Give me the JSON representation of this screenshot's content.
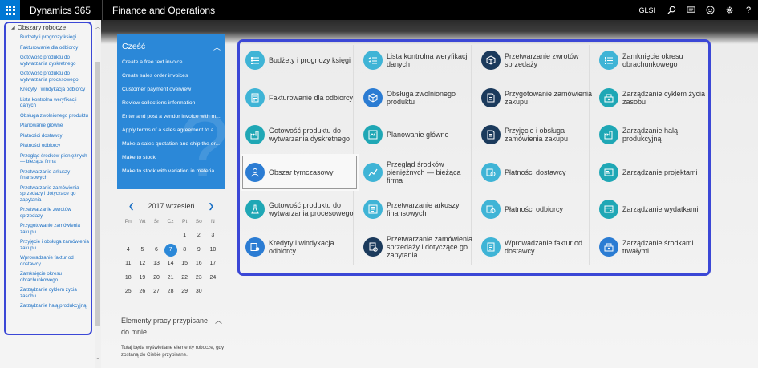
{
  "topbar": {
    "app_name": "Dynamics 365",
    "module_name": "Finance and Operations",
    "company": "GLSI"
  },
  "sidebar": {
    "header": "Obszary robocze",
    "items": [
      "Budżety i prognozy księgi",
      "Fakturowanie dla odbiorcy",
      "Gotowość produktu do wytwarzania dyskretnego",
      "Gotowość produktu do wytwarzania procesowego",
      "Kredyty i windykacja odbiorcy",
      "Lista kontrolna weryfikacji danych",
      "Obsługa zwolnionego produktu",
      "Planowanie główne",
      "Płatności dostawcy",
      "Płatności odbiorcy",
      "Przegląd środków pieniężnych — bieżąca firma",
      "Przetwarzanie arkuszy finansowych",
      "Przetwarzanie zamówienia sprzedaży i dotyczące go zapytania",
      "Przetwarzanie zwrotów sprzedaży",
      "Przygotowanie zamówienia zakupu",
      "Przyjęcie i obsługa zamówienia zakupu",
      "Wprowadzanie faktur od dostawcy",
      "Zamknięcie okresu obrachunkowego",
      "Zarządzanie cyklem życia zasobu",
      "Zarządzanie halą produkcyjną"
    ]
  },
  "frequent": {
    "title": "Cześć",
    "items": [
      "Create a free text invoice",
      "Create sales order invoices",
      "Customer payment overview",
      "Review collections information",
      "Enter and post a vendor invoice with m...",
      "Apply terms of a sales agreement to a...",
      "Make a sales quotation and ship the or...",
      "Make to stock",
      "Make to stock with variation in materia..."
    ]
  },
  "calendar": {
    "month_label": "2017 wrzesień",
    "weekdays": [
      "Pn",
      "Wt",
      "Śr",
      "Cz",
      "Pt",
      "So",
      "N"
    ],
    "rows": [
      [
        "",
        "",
        "",
        "",
        "1",
        "2",
        "3"
      ],
      [
        "4",
        "5",
        "6",
        "7",
        "8",
        "9",
        "10"
      ],
      [
        "11",
        "12",
        "13",
        "14",
        "15",
        "16",
        "17"
      ],
      [
        "18",
        "19",
        "20",
        "21",
        "22",
        "23",
        "24"
      ],
      [
        "25",
        "26",
        "27",
        "28",
        "29",
        "30",
        ""
      ]
    ],
    "today": "7"
  },
  "assigned": {
    "title": "Elementy pracy przypisane do mnie",
    "description": "Tutaj będą wyświetlane elementy robocze, gdy zostaną do Ciebie przypisane."
  },
  "tiles": [
    {
      "label": "Budżety i prognozy księgi",
      "color": "teal",
      "icon": "list-icon"
    },
    {
      "label": "Lista kontrolna weryfikacji danych",
      "color": "teal",
      "icon": "checklist-icon"
    },
    {
      "label": "Przetwarzanie zwrotów sprzedaży",
      "color": "dark",
      "icon": "box-icon"
    },
    {
      "label": "Zamknięcie okresu obrachunkowego",
      "color": "teal",
      "icon": "list-icon"
    },
    {
      "label": "Fakturowanie dla odbiorcy",
      "color": "teal",
      "icon": "invoice-icon"
    },
    {
      "label": "Obsługa zwolnionego produktu",
      "color": "blue",
      "icon": "box-icon"
    },
    {
      "label": "Przygotowanie zamówienia zakupu",
      "color": "dark",
      "icon": "document-icon"
    },
    {
      "label": "Zarządzanie cyklem życia zasobu",
      "color": "cyan",
      "icon": "asset-icon"
    },
    {
      "label": "Gotowość produktu do wytwarzania dyskretnego",
      "color": "cyan",
      "icon": "factory-icon"
    },
    {
      "label": "Planowanie główne",
      "color": "cyan",
      "icon": "plan-icon"
    },
    {
      "label": "Przyjęcie i obsługa zamówienia zakupu",
      "color": "dark",
      "icon": "document-icon"
    },
    {
      "label": "Zarządzanie halą produkcyjną",
      "color": "cyan",
      "icon": "factory-icon"
    },
    {
      "label": "Obszar tymczasowy",
      "color": "blue",
      "icon": "person-icon",
      "selected": true
    },
    {
      "label": "Przegląd środków pieniężnych — bieżąca firma",
      "color": "teal",
      "icon": "chart-icon"
    },
    {
      "label": "Płatności dostawcy",
      "color": "teal",
      "icon": "payment-icon"
    },
    {
      "label": "Zarządzanie projektami",
      "color": "cyan",
      "icon": "project-icon"
    },
    {
      "label": "Gotowość produktu do wytwarzania procesowego",
      "color": "cyan",
      "icon": "flask-icon"
    },
    {
      "label": "Przetwarzanie arkuszy finansowych",
      "color": "teal",
      "icon": "journal-icon"
    },
    {
      "label": "Płatności odbiorcy",
      "color": "teal",
      "icon": "payment-icon"
    },
    {
      "label": "Zarządzanie wydatkami",
      "color": "cyan",
      "icon": "expense-icon"
    },
    {
      "label": "Kredyty i windykacja odbiorcy",
      "color": "blue",
      "icon": "credit-icon"
    },
    {
      "label": "Przetwarzanie zamówienia sprzedaży i dotyczące go zapytania",
      "color": "dark",
      "icon": "order-icon"
    },
    {
      "label": "Wprowadzanie faktur od dostawcy",
      "color": "teal",
      "icon": "invoice-icon"
    },
    {
      "label": "Zarządzanie środkami trwałymi",
      "color": "blue",
      "icon": "asset-icon"
    }
  ]
}
